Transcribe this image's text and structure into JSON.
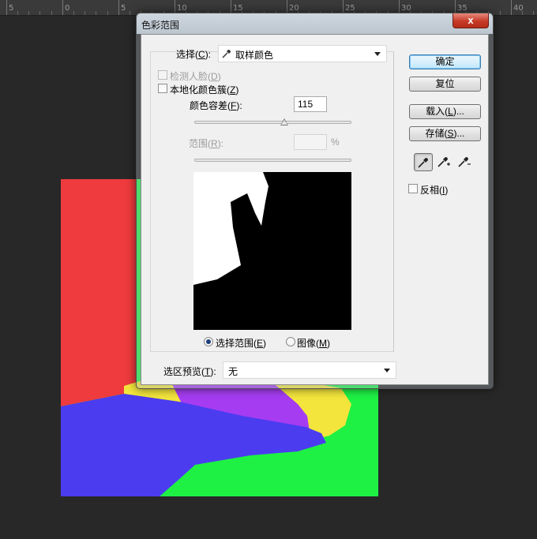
{
  "ruler": {
    "labels": [
      "5",
      "0",
      "5",
      "10",
      "15",
      "20",
      "25",
      "30",
      "35",
      "40"
    ]
  },
  "colors": {
    "red": "#ef3b3d",
    "yellow": "#f3e53c",
    "purple": "#a63cf1",
    "blue": "#4b3cf0",
    "green": "#1ef144"
  },
  "dialog": {
    "title": "色彩范围",
    "close_label": "x",
    "select_label": "选择",
    "select_key": "C",
    "select_value": "取样颜色",
    "detect_faces_label": "检测人脸",
    "detect_faces_key": "D",
    "localized_clusters_label": "本地化颜色簇",
    "localized_clusters_key": "Z",
    "fuzziness_label": "颜色容差",
    "fuzziness_key": "F",
    "fuzziness_value": "115",
    "range_label": "范围",
    "range_key": "R",
    "range_unit": "%",
    "view_selection_label": "选择范围",
    "view_selection_key": "E",
    "view_image_label": "图像",
    "view_image_key": "M",
    "selection_preview_label": "选区预览",
    "selection_preview_key": "T",
    "selection_preview_value": "无",
    "ok_label": "确定",
    "reset_label": "复位",
    "load_label": "载入",
    "load_key": "L",
    "save_label": "存储",
    "save_key": "S",
    "invert_label": "反相",
    "invert_key": "I"
  }
}
